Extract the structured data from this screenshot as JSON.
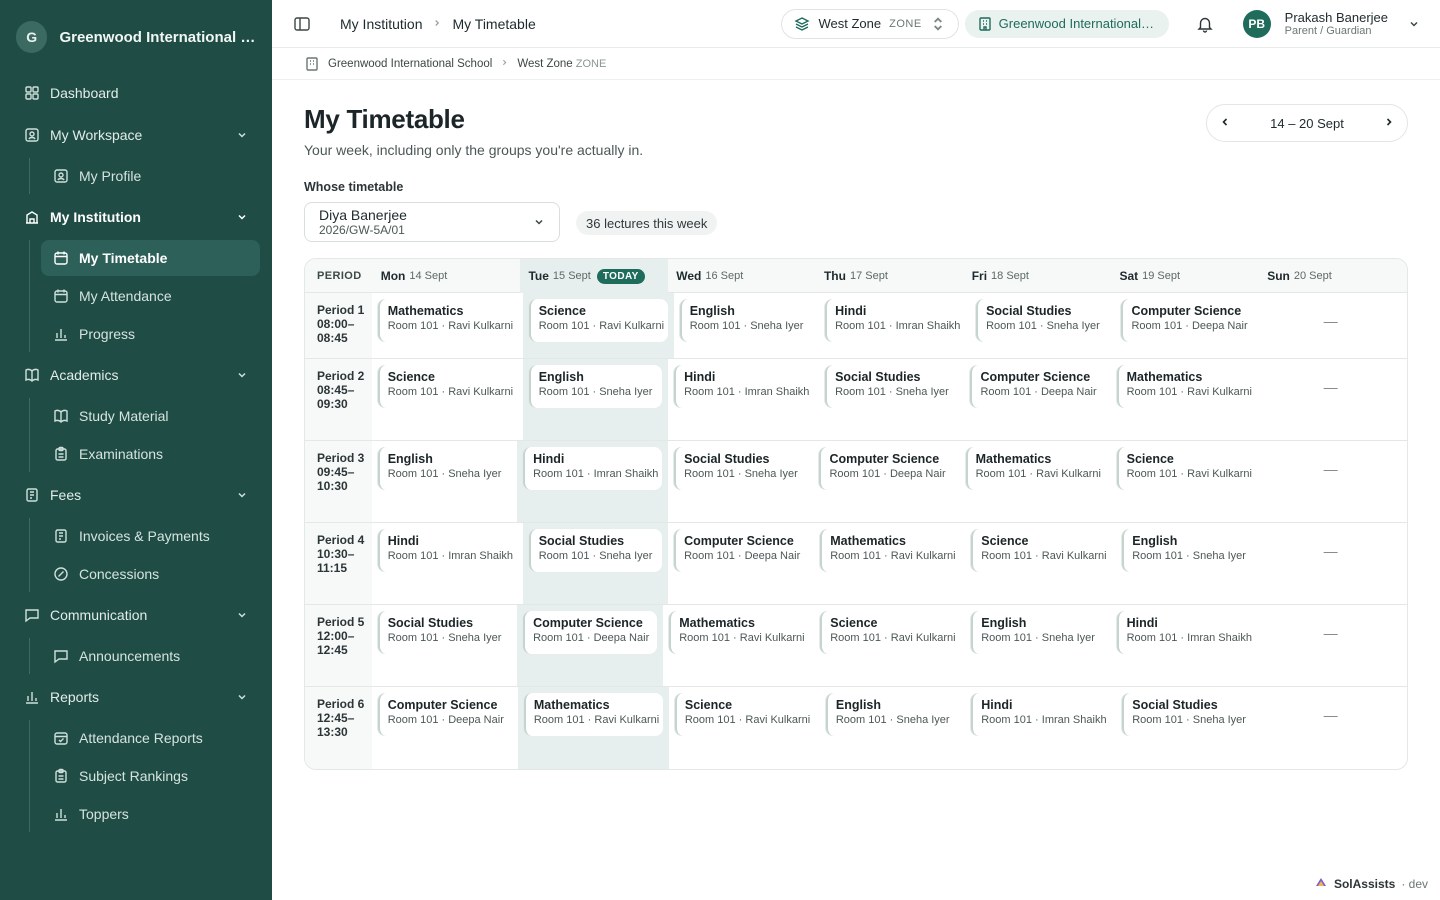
{
  "sidebar": {
    "logo_letter": "G",
    "school": "Greenwood International School",
    "dashboard": "Dashboard",
    "workspace": {
      "label": "My Workspace",
      "items": [
        "My Profile"
      ]
    },
    "institution": {
      "label": "My Institution",
      "items": [
        "My Timetable",
        "My Attendance",
        "Progress"
      ]
    },
    "academics": {
      "label": "Academics",
      "items": [
        "Study Material",
        "Examinations"
      ]
    },
    "fees": {
      "label": "Fees",
      "items": [
        "Invoices & Payments",
        "Concessions"
      ]
    },
    "communication": {
      "label": "Communication",
      "items": [
        "Announcements"
      ]
    },
    "reports": {
      "label": "Reports",
      "items": [
        "Attendance Reports",
        "Subject Rankings",
        "Toppers"
      ]
    }
  },
  "topbar": {
    "crumb_parent": "My Institution",
    "crumb_current": "My Timetable",
    "zone_name": "West Zone",
    "zone_tag": "ZONE",
    "school_short": "Greenwood International School",
    "avatar_initials": "PB",
    "user_name": "Prakash Banerjee",
    "user_role": "Parent / Guardian"
  },
  "crumb2": {
    "school": "Greenwood International School",
    "zone": "West Zone",
    "zone_tag": "ZONE"
  },
  "page": {
    "title": "My Timetable",
    "subtitle": "Your week, including only the groups you're actually in.",
    "week_range": "14 – 20 Sept",
    "whose_label": "Whose timetable",
    "student_name": "Diya Banerjee",
    "student_group": "2026/GW-5A/01",
    "lecture_count": "36 lectures this week"
  },
  "timetable": {
    "period_header": "PERIOD",
    "today_badge": "TODAY",
    "days": [
      {
        "name": "Mon",
        "date": "14 Sept"
      },
      {
        "name": "Tue",
        "date": "15 Sept"
      },
      {
        "name": "Wed",
        "date": "16 Sept"
      },
      {
        "name": "Thu",
        "date": "17 Sept"
      },
      {
        "name": "Fri",
        "date": "18 Sept"
      },
      {
        "name": "Sat",
        "date": "19 Sept"
      },
      {
        "name": "Sun",
        "date": "20 Sept"
      }
    ],
    "empty_mark": "—",
    "periods": [
      {
        "label": "Period 1",
        "time": "08:00–08:45",
        "cells": [
          [
            "Mathematics",
            "Room 101 · Ravi Kulkarni"
          ],
          [
            "Science",
            "Room 101 · Ravi Kulkarni"
          ],
          [
            "English",
            "Room 101 · Sneha Iyer"
          ],
          [
            "Hindi",
            "Room 101 · Imran Shaikh"
          ],
          [
            "Social Studies",
            "Room 101 · Sneha Iyer"
          ],
          [
            "Computer Science",
            "Room 101 · Deepa Nair"
          ]
        ]
      },
      {
        "label": "Period 2",
        "time": "08:45–09:30",
        "cells": [
          [
            "Science",
            "Room 101 · Ravi Kulkarni"
          ],
          [
            "English",
            "Room 101 · Sneha Iyer"
          ],
          [
            "Hindi",
            "Room 101 · Imran Shaikh"
          ],
          [
            "Social Studies",
            "Room 101 · Sneha Iyer"
          ],
          [
            "Computer Science",
            "Room 101 · Deepa Nair"
          ],
          [
            "Mathematics",
            "Room 101 · Ravi Kulkarni"
          ]
        ]
      },
      {
        "label": "Period 3",
        "time": "09:45–10:30",
        "cells": [
          [
            "English",
            "Room 101 · Sneha Iyer"
          ],
          [
            "Hindi",
            "Room 101 · Imran Shaikh"
          ],
          [
            "Social Studies",
            "Room 101 · Sneha Iyer"
          ],
          [
            "Computer Science",
            "Room 101 · Deepa Nair"
          ],
          [
            "Mathematics",
            "Room 101 · Ravi Kulkarni"
          ],
          [
            "Science",
            "Room 101 · Ravi Kulkarni"
          ]
        ]
      },
      {
        "label": "Period 4",
        "time": "10:30–11:15",
        "cells": [
          [
            "Hindi",
            "Room 101 · Imran Shaikh"
          ],
          [
            "Social Studies",
            "Room 101 · Sneha Iyer"
          ],
          [
            "Computer Science",
            "Room 101 · Deepa Nair"
          ],
          [
            "Mathematics",
            "Room 101 · Ravi Kulkarni"
          ],
          [
            "Science",
            "Room 101 · Ravi Kulkarni"
          ],
          [
            "English",
            "Room 101 · Sneha Iyer"
          ]
        ]
      },
      {
        "label": "Period 5",
        "time": "12:00–12:45",
        "cells": [
          [
            "Social Studies",
            "Room 101 · Sneha Iyer"
          ],
          [
            "Computer Science",
            "Room 101 · Deepa Nair"
          ],
          [
            "Mathematics",
            "Room 101 · Ravi Kulkarni"
          ],
          [
            "Science",
            "Room 101 · Ravi Kulkarni"
          ],
          [
            "English",
            "Room 101 · Sneha Iyer"
          ],
          [
            "Hindi",
            "Room 101 · Imran Shaikh"
          ]
        ]
      },
      {
        "label": "Period 6",
        "time": "12:45–13:30",
        "cells": [
          [
            "Computer Science",
            "Room 101 · Deepa Nair"
          ],
          [
            "Mathematics",
            "Room 101 · Ravi Kulkarni"
          ],
          [
            "Science",
            "Room 101 · Ravi Kulkarni"
          ],
          [
            "English",
            "Room 101 · Sneha Iyer"
          ],
          [
            "Hindi",
            "Room 101 · Imran Shaikh"
          ],
          [
            "Social Studies",
            "Room 101 · Sneha Iyer"
          ]
        ]
      }
    ]
  },
  "footer": {
    "brand": "SolAssists",
    "env": "· dev"
  },
  "colors": {
    "sidebar_bg": "#1f4d46",
    "accent": "#1f6b5c",
    "today_bg": "#e6efed"
  }
}
